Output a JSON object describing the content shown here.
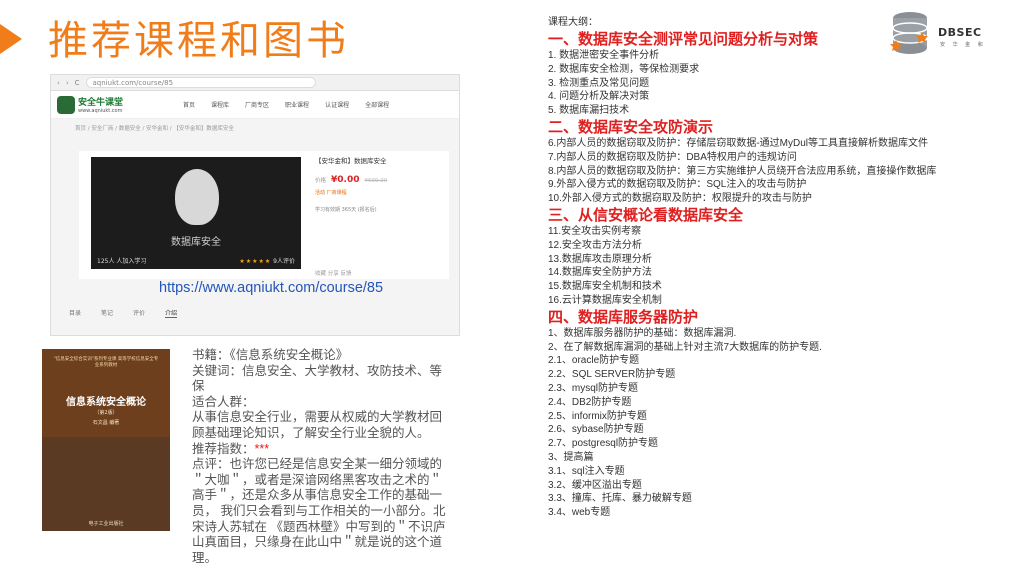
{
  "slide": {
    "title": "推荐课程和图书"
  },
  "screenshot": {
    "address_url": "aqniukt.com/course/85",
    "nav_back": "‹",
    "nav_forward": "›",
    "nav_reload": "C",
    "logo_name": "安全牛课堂",
    "logo_url": "www.aqniukt.com",
    "nav_items": [
      "首页",
      "课程库",
      "厂商专区",
      "职业课程",
      "认证课程",
      "全部课程"
    ],
    "breadcrumb": "首页 / 安全厂商 / 数据安全 / 安华金和 / 【安华金和】数据库安全",
    "cover_label": "数据库安全",
    "cover_footer": "125人 人加入学习",
    "cover_stars": "★★★★★",
    "cover_rating": "9人评价",
    "course_title": "【安华金和】数据库安全",
    "price_label": "价格",
    "price": "¥0.00",
    "original_price": "¥699.00",
    "promo_label": "活动",
    "promo_text": "厂商课程",
    "meta_text": "学习有效期    365天 (报名后)",
    "tools_text": "收藏    分享    反馈",
    "course_url": "https://www.aqniukt.com/course/85",
    "tabs": [
      "目录",
      "笔记",
      "评价",
      "介绍"
    ]
  },
  "book": {
    "top_text": "\"信息安全综合实训\"系列专业课 高等学校信息安全专业系列教材",
    "title": "信息系统安全概论",
    "edition": "（第2版）",
    "author": "石文昌  编著",
    "publisher": "电子工业出版社"
  },
  "bookinfo": {
    "title_line": "书籍：《信息系统安全概论》",
    "keywords_line": "关键词：信息安全、大学教材、攻防技术、等保",
    "audience_label": "适合人群：",
    "audience_text": "从事信息安全行业，需要从权威的大学教材回顾基础理论知识，了解安全行业全貌的人。",
    "rating_label": "推荐指数：",
    "rating_stars": "***",
    "review_text": "点评：也许您已经是信息安全某一细分领域的＂大咖＂，或者是深谙网络黑客攻击之术的＂高手＂，还是众多从事信息安全工作的基础一员， 我们只会看到与工作相关的一小部分。北宋诗人苏轼在 《题西林壁》中写到的＂不识庐山真面目，只缘身在此山中＂就是说的这个道理。"
  },
  "outline": {
    "label": "课程大纲：",
    "sections": [
      {
        "heading": "一、数据库安全测评常见问题分析与对策",
        "items": [
          "1. 数据泄密安全事件分析",
          "2. 数据库安全检测，等保检测要求",
          "3. 检测重点及常见问题",
          "4. 问题分析及解决对策",
          "5. 数据库漏扫技术"
        ]
      },
      {
        "heading": "二、数据库安全攻防演示",
        "items": [
          "6.内部人员的数据窃取及防护：存储层窃取数据-通过MyDul等工具直接解析数据库文件",
          "7.内部人员的数据窃取及防护：DBA特权用户的违规访问",
          "8.内部人员的数据窃取及防护：第三方实施维护人员绕开合法应用系统，直接操作数据库",
          "9.外部入侵方式的数据窃取及防护：SQL注入的攻击与防护",
          "10.外部入侵方式的数据窃取及防护：权限提升的攻击与防护"
        ]
      },
      {
        "heading": "三、从信安概论看数据库安全",
        "items": [
          "11.安全攻击实例考察",
          "12.安全攻击方法分析",
          "13.数据库攻击原理分析",
          "14.数据库安全防护方法",
          "15.数据库安全机制和技术",
          "16.云计算数据库安全机制"
        ]
      },
      {
        "heading": "四、数据库服务器防护",
        "items": [
          "1、数据库服务器防护的基础：数据库漏洞.",
          "2、在了解数据库漏洞的基础上针对主流7大数据库的防护专题.",
          "2.1、oracle防护专题",
          "2.2、SQL SERVER防护专题",
          "2.3、mysql防护专题",
          "2.4、DB2防护专题",
          "2.5、informix防护专题",
          "2.6、sybase防护专题",
          "2.7、postgresql防护专题",
          "3、提高篇",
          "3.1、sql注入专题",
          "3.2、缓冲区溢出专题",
          "3.3、撞库、托库、暴力破解专题",
          "3.4、web专题"
        ]
      }
    ]
  },
  "brand": {
    "name": "DBSEC",
    "subtitle": "安 华 金 和"
  },
  "colors": {
    "title_orange": "#f07d1a",
    "heading_red": "#e02020",
    "link_blue": "#2356b8"
  }
}
